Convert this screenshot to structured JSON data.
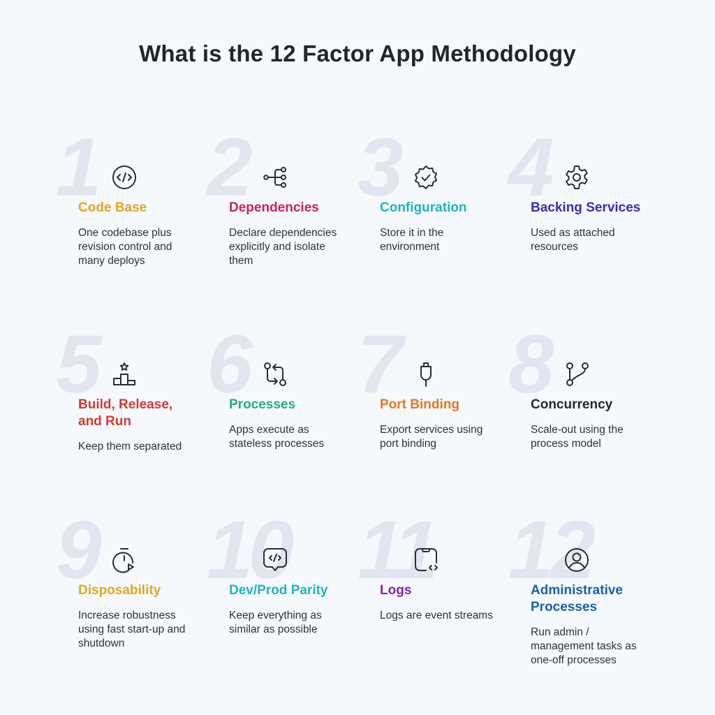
{
  "title": "What is the 12 Factor App Methodology",
  "factors": [
    {
      "number": "1",
      "title": "Code Base",
      "description": "One codebase plus revision control and many deploys",
      "icon": "code-circle-icon",
      "color": "#e0a820"
    },
    {
      "number": "2",
      "title": "Dependencies",
      "description": "Declare dependencies explicitly and isolate them",
      "icon": "hierarchy-icon",
      "color": "#c8245a"
    },
    {
      "number": "3",
      "title": "Configuration",
      "description": "Store it in the environment",
      "icon": "verified-badge-icon",
      "color": "#1fb3c2"
    },
    {
      "number": "4",
      "title": "Backing Services",
      "description": "Used as attached resources",
      "icon": "gear-icon",
      "color": "#3d2ab8"
    },
    {
      "number": "5",
      "title": "Build, Release, and Run",
      "description": "Keep them separated",
      "icon": "podium-star-icon",
      "color": "#d33a33"
    },
    {
      "number": "6",
      "title": "Processes",
      "description": "Apps execute as stateless processes",
      "icon": "git-compare-icon",
      "color": "#22ad84"
    },
    {
      "number": "7",
      "title": "Port Binding",
      "description": "Export services using port binding",
      "icon": "plug-icon",
      "color": "#e37826"
    },
    {
      "number": "8",
      "title": "Concurrency",
      "description": "Scale-out using the process model",
      "icon": "git-branch-icon",
      "color": "#26282e"
    },
    {
      "number": "9",
      "title": "Disposability",
      "description": "Increase robustness using fast start-up and shutdown",
      "icon": "timer-play-icon",
      "color": "#e0a820"
    },
    {
      "number": "10",
      "title": "Dev/Prod Parity",
      "description": "Keep everything as similar as possible",
      "icon": "code-message-icon",
      "color": "#1fb3c2"
    },
    {
      "number": "11",
      "title": "Logs",
      "description": "Logs are event streams",
      "icon": "device-code-icon",
      "color": "#8a1fb0"
    },
    {
      "number": "12",
      "title": "Administrative Processes",
      "description": "Run admin / management tasks as one-off processes",
      "icon": "user-circle-icon",
      "color": "#1a5fae"
    }
  ]
}
